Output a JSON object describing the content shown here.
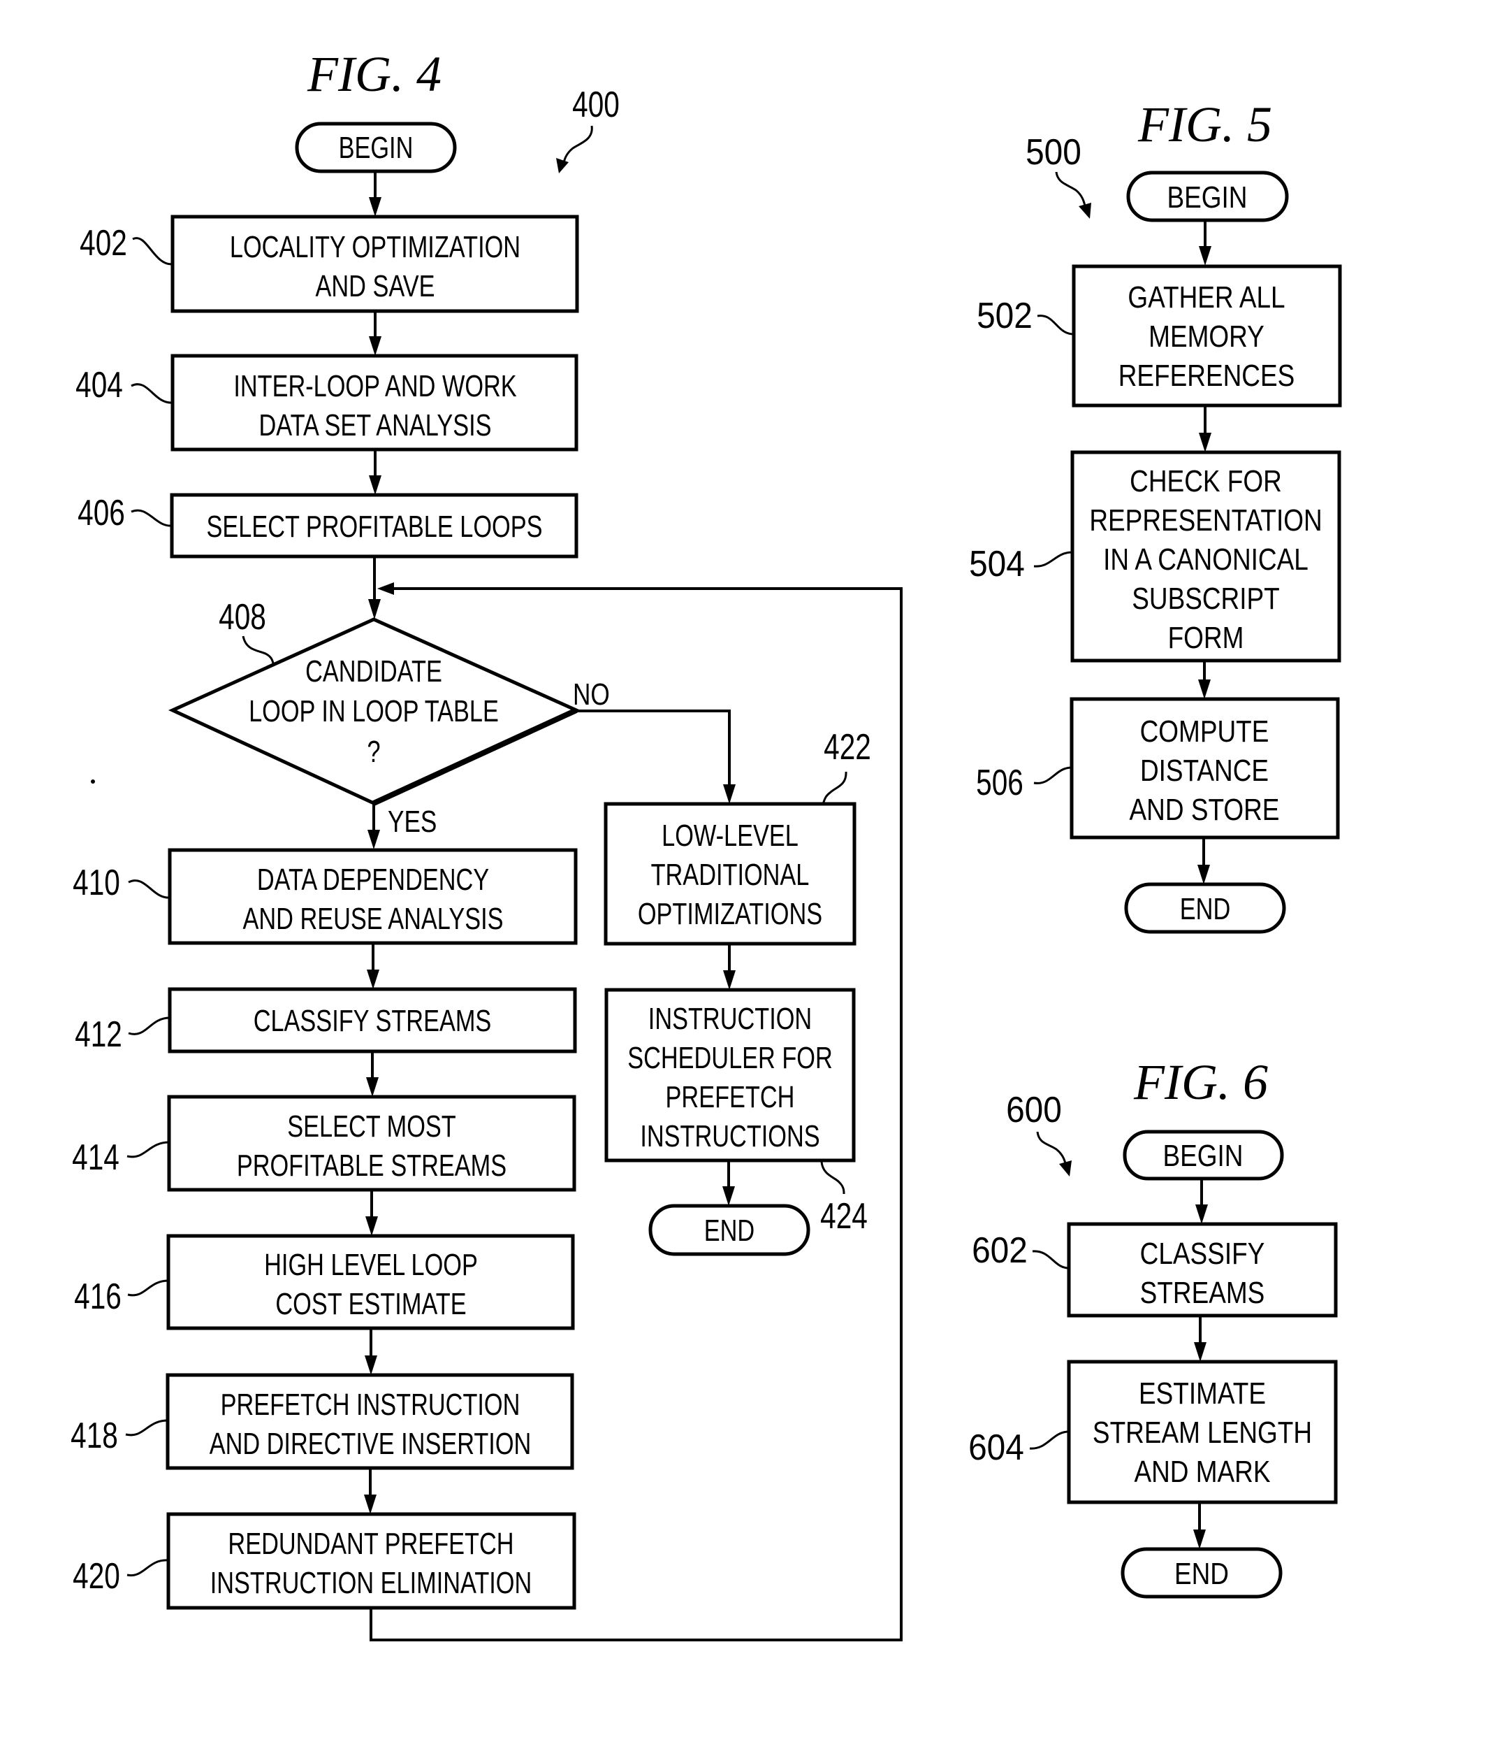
{
  "fig4": {
    "title": "FIG. 4",
    "ref": "400",
    "begin": "BEGIN",
    "end": "END",
    "decision": {
      "ref": "408",
      "lines": [
        "CANDIDATE",
        "LOOP IN LOOP TABLE",
        "?"
      ],
      "yes_label": "YES",
      "no_label": "NO"
    },
    "steps": [
      {
        "ref": "402",
        "lines": [
          "LOCALITY OPTIMIZATION",
          "AND SAVE"
        ]
      },
      {
        "ref": "404",
        "lines": [
          "INTER-LOOP AND WORK",
          "DATA SET ANALYSIS"
        ]
      },
      {
        "ref": "406",
        "lines": [
          "SELECT PROFITABLE LOOPS"
        ]
      },
      {
        "ref": "410",
        "lines": [
          "DATA DEPENDENCY",
          "AND REUSE ANALYSIS"
        ]
      },
      {
        "ref": "412",
        "lines": [
          "CLASSIFY STREAMS"
        ]
      },
      {
        "ref": "414",
        "lines": [
          "SELECT MOST",
          "PROFITABLE STREAMS"
        ]
      },
      {
        "ref": "416",
        "lines": [
          "HIGH LEVEL LOOP",
          "COST ESTIMATE"
        ]
      },
      {
        "ref": "418",
        "lines": [
          "PREFETCH INSTRUCTION",
          "AND DIRECTIVE INSERTION"
        ]
      },
      {
        "ref": "420",
        "lines": [
          "REDUNDANT PREFETCH",
          "INSTRUCTION ELIMINATION"
        ]
      },
      {
        "ref": "422",
        "lines": [
          "LOW-LEVEL",
          "TRADITIONAL",
          "OPTIMIZATIONS"
        ]
      },
      {
        "ref": "424",
        "lines": [
          "INSTRUCTION",
          "SCHEDULER FOR",
          "PREFETCH",
          "INSTRUCTIONS"
        ]
      }
    ]
  },
  "fig5": {
    "title": "FIG. 5",
    "ref": "500",
    "begin": "BEGIN",
    "end": "END",
    "steps": [
      {
        "ref": "502",
        "lines": [
          "GATHER ALL",
          "MEMORY",
          "REFERENCES"
        ]
      },
      {
        "ref": "504",
        "lines": [
          "CHECK FOR",
          "REPRESENTATION",
          "IN A CANONICAL",
          "SUBSCRIPT",
          "FORM"
        ]
      },
      {
        "ref": "506",
        "lines": [
          "COMPUTE",
          "DISTANCE",
          "AND STORE"
        ]
      }
    ]
  },
  "fig6": {
    "title": "FIG. 6",
    "ref": "600",
    "begin": "BEGIN",
    "end": "END",
    "steps": [
      {
        "ref": "602",
        "lines": [
          "CLASSIFY",
          "STREAMS"
        ]
      },
      {
        "ref": "604",
        "lines": [
          "ESTIMATE",
          "STREAM LENGTH",
          "AND MARK"
        ]
      }
    ]
  }
}
